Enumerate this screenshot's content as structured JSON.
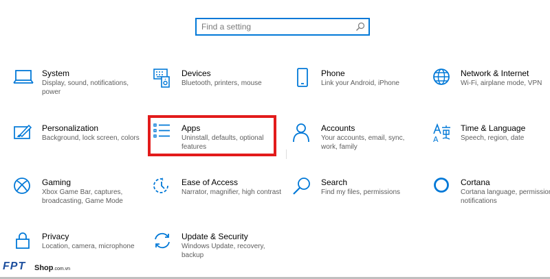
{
  "search": {
    "placeholder": "Find a setting"
  },
  "colors": {
    "accent": "#0078d7",
    "highlight": "#e21b1b"
  },
  "tiles": [
    {
      "title": "System",
      "desc": "Display, sound, notifications, power",
      "icon": "laptop-icon"
    },
    {
      "title": "Devices",
      "desc": "Bluetooth, printers, mouse",
      "icon": "keyboard-speaker-icon"
    },
    {
      "title": "Phone",
      "desc": "Link your Android, iPhone",
      "icon": "phone-icon"
    },
    {
      "title": "Network & Internet",
      "desc": "Wi-Fi, airplane mode, VPN",
      "icon": "globe-icon"
    },
    {
      "title": "Personalization",
      "desc": "Background, lock screen, colors",
      "icon": "paintbrush-icon"
    },
    {
      "title": "Apps",
      "desc": "Uninstall, defaults, optional features",
      "icon": "apps-list-icon"
    },
    {
      "title": "Accounts",
      "desc": "Your accounts, email, sync, work, family",
      "icon": "person-icon"
    },
    {
      "title": "Time & Language",
      "desc": "Speech, region, date",
      "icon": "time-language-icon"
    },
    {
      "title": "Gaming",
      "desc": "Xbox Game Bar, captures, broadcasting, Game Mode",
      "icon": "xbox-icon"
    },
    {
      "title": "Ease of Access",
      "desc": "Narrator, magnifier, high contrast",
      "icon": "ease-of-access-icon"
    },
    {
      "title": "Search",
      "desc": "Find my files, permissions",
      "icon": "magnifier-icon"
    },
    {
      "title": "Cortana",
      "desc": "Cortana language, permissions, notifications",
      "icon": "cortana-icon"
    },
    {
      "title": "Privacy",
      "desc": "Location, camera, microphone",
      "icon": "lock-icon"
    },
    {
      "title": "Update & Security",
      "desc": "Windows Update, recovery, backup",
      "icon": "sync-arrows-icon"
    }
  ],
  "watermark": {
    "brand": "FPT",
    "shop": "Shop",
    "domain": ".com.vn"
  }
}
